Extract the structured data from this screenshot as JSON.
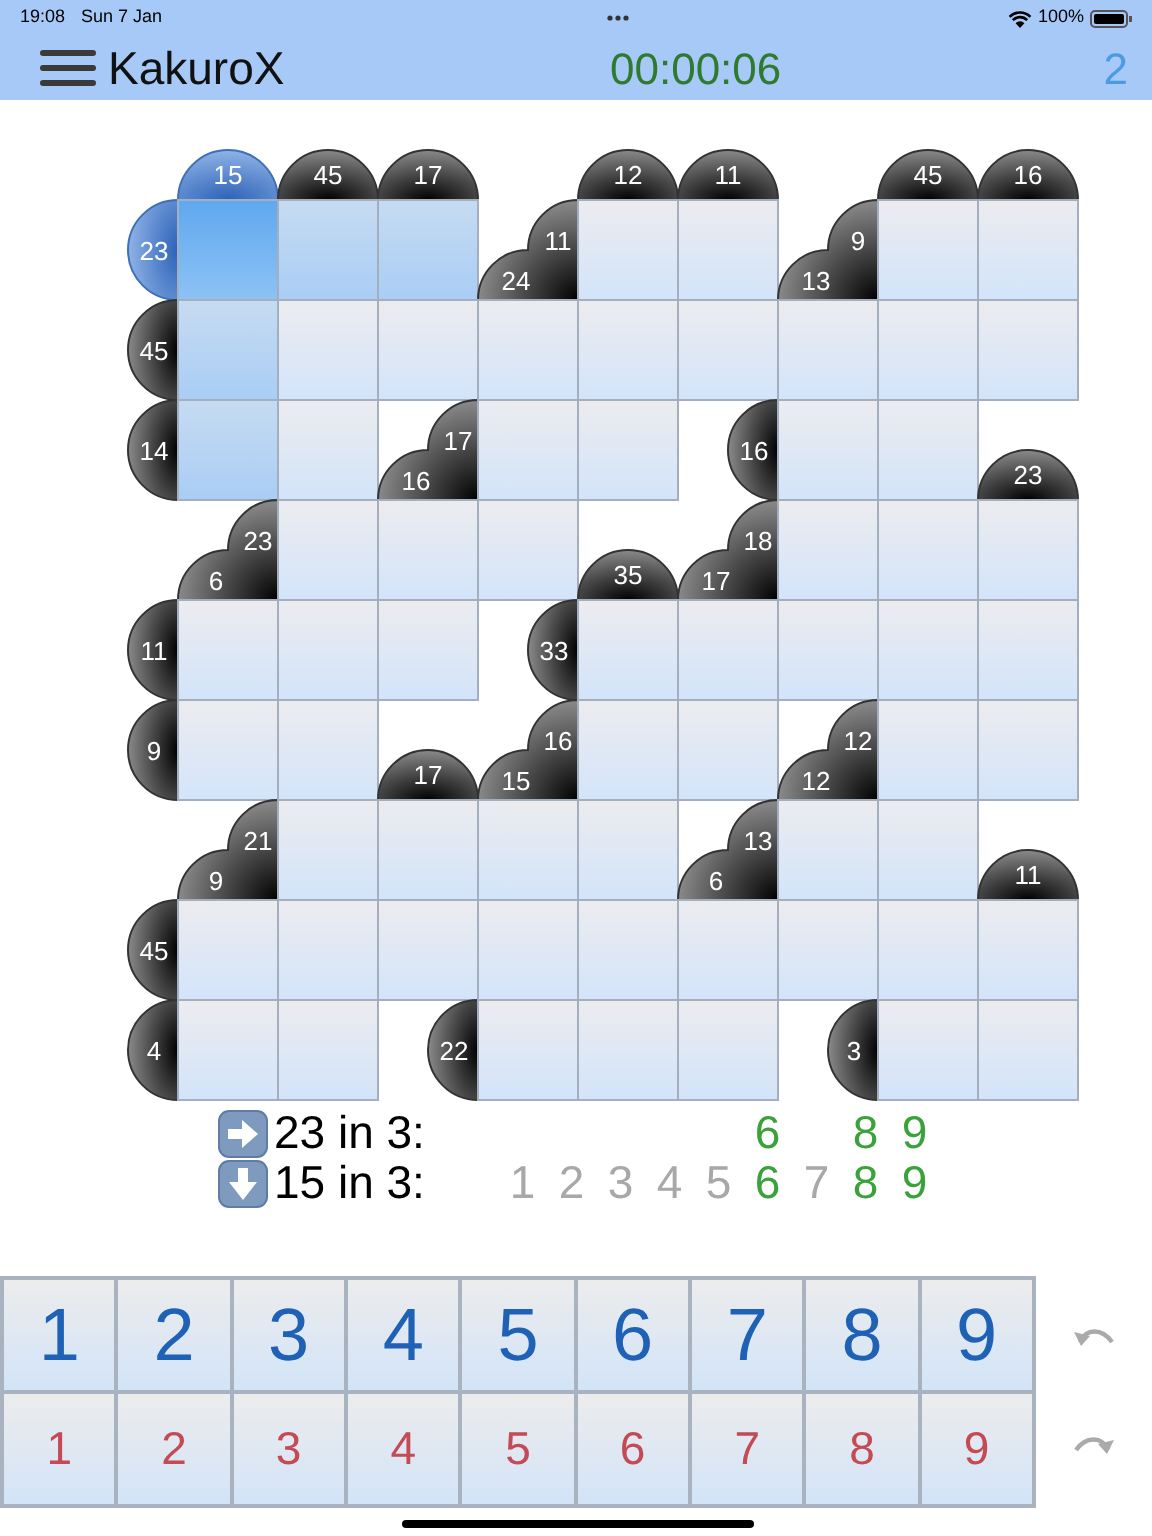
{
  "status_bar": {
    "time": "19:08",
    "date": "Sun 7 Jan",
    "battery": "100%"
  },
  "header": {
    "title": "KakuroX",
    "timer": "00:00:06",
    "count": "2"
  },
  "grid": {
    "rows": [
      [
        {
          "kind": "empty"
        },
        {
          "kind": "clue",
          "down": "15",
          "selected": true
        },
        {
          "kind": "clue",
          "down": "45",
          "selected": false
        },
        {
          "kind": "clue",
          "down": "17",
          "selected": false
        },
        {
          "kind": "empty"
        },
        {
          "kind": "clue",
          "down": "12",
          "selected": false
        },
        {
          "kind": "clue",
          "down": "11",
          "selected": false
        },
        {
          "kind": "empty"
        },
        {
          "kind": "clue",
          "down": "45",
          "selected": false
        },
        {
          "kind": "clue",
          "down": "16",
          "selected": false
        }
      ],
      [
        {
          "kind": "clue",
          "across": "23",
          "selected": true
        },
        {
          "kind": "cell",
          "selected": true
        },
        {
          "kind": "cell",
          "selected": false,
          "highlighted": true
        },
        {
          "kind": "cell",
          "selected": false,
          "highlighted": true
        },
        {
          "kind": "clue",
          "down": "24",
          "across": "11",
          "selected": false
        },
        {
          "kind": "cell",
          "selected": false,
          "highlighted": false
        },
        {
          "kind": "cell",
          "selected": false,
          "highlighted": false
        },
        {
          "kind": "clue",
          "down": "13",
          "across": "9",
          "selected": false
        },
        {
          "kind": "cell",
          "selected": false,
          "highlighted": false
        },
        {
          "kind": "cell",
          "selected": false,
          "highlighted": false
        }
      ],
      [
        {
          "kind": "clue",
          "across": "45",
          "selected": false
        },
        {
          "kind": "cell",
          "selected": false,
          "highlighted": true
        },
        {
          "kind": "cell",
          "selected": false,
          "highlighted": false
        },
        {
          "kind": "cell",
          "selected": false,
          "highlighted": false
        },
        {
          "kind": "cell",
          "selected": false,
          "highlighted": false
        },
        {
          "kind": "cell",
          "selected": false,
          "highlighted": false
        },
        {
          "kind": "cell",
          "selected": false,
          "highlighted": false
        },
        {
          "kind": "cell",
          "selected": false,
          "highlighted": false
        },
        {
          "kind": "cell",
          "selected": false,
          "highlighted": false
        },
        {
          "kind": "cell",
          "selected": false,
          "highlighted": false
        }
      ],
      [
        {
          "kind": "clue",
          "across": "14",
          "selected": false
        },
        {
          "kind": "cell",
          "selected": false,
          "highlighted": true
        },
        {
          "kind": "cell",
          "selected": false,
          "highlighted": false
        },
        {
          "kind": "clue",
          "down": "16",
          "across": "17",
          "selected": false
        },
        {
          "kind": "cell",
          "selected": false,
          "highlighted": false
        },
        {
          "kind": "cell",
          "selected": false,
          "highlighted": false
        },
        {
          "kind": "clue",
          "across": "16",
          "selected": false
        },
        {
          "kind": "cell",
          "selected": false,
          "highlighted": false
        },
        {
          "kind": "cell",
          "selected": false,
          "highlighted": false
        },
        {
          "kind": "clue",
          "down": "23",
          "selected": false
        }
      ],
      [
        {
          "kind": "empty"
        },
        {
          "kind": "clue",
          "down": "6",
          "across": "23",
          "selected": false
        },
        {
          "kind": "cell",
          "selected": false,
          "highlighted": false
        },
        {
          "kind": "cell",
          "selected": false,
          "highlighted": false
        },
        {
          "kind": "cell",
          "selected": false,
          "highlighted": false
        },
        {
          "kind": "clue",
          "down": "35",
          "selected": false
        },
        {
          "kind": "clue",
          "down": "17",
          "across": "18",
          "selected": false
        },
        {
          "kind": "cell",
          "selected": false,
          "highlighted": false
        },
        {
          "kind": "cell",
          "selected": false,
          "highlighted": false
        },
        {
          "kind": "cell",
          "selected": false,
          "highlighted": false
        }
      ],
      [
        {
          "kind": "clue",
          "across": "11",
          "selected": false
        },
        {
          "kind": "cell",
          "selected": false,
          "highlighted": false
        },
        {
          "kind": "cell",
          "selected": false,
          "highlighted": false
        },
        {
          "kind": "cell",
          "selected": false,
          "highlighted": false
        },
        {
          "kind": "clue",
          "across": "33",
          "selected": false
        },
        {
          "kind": "cell",
          "selected": false,
          "highlighted": false
        },
        {
          "kind": "cell",
          "selected": false,
          "highlighted": false
        },
        {
          "kind": "cell",
          "selected": false,
          "highlighted": false
        },
        {
          "kind": "cell",
          "selected": false,
          "highlighted": false
        },
        {
          "kind": "cell",
          "selected": false,
          "highlighted": false
        }
      ],
      [
        {
          "kind": "clue",
          "across": "9",
          "selected": false
        },
        {
          "kind": "cell",
          "selected": false,
          "highlighted": false
        },
        {
          "kind": "cell",
          "selected": false,
          "highlighted": false
        },
        {
          "kind": "clue",
          "down": "17",
          "selected": false
        },
        {
          "kind": "clue",
          "down": "15",
          "across": "16",
          "selected": false
        },
        {
          "kind": "cell",
          "selected": false,
          "highlighted": false
        },
        {
          "kind": "cell",
          "selected": false,
          "highlighted": false
        },
        {
          "kind": "clue",
          "down": "12",
          "across": "12",
          "selected": false
        },
        {
          "kind": "cell",
          "selected": false,
          "highlighted": false
        },
        {
          "kind": "cell",
          "selected": false,
          "highlighted": false
        }
      ],
      [
        {
          "kind": "empty"
        },
        {
          "kind": "clue",
          "down": "9",
          "across": "21",
          "selected": false
        },
        {
          "kind": "cell",
          "selected": false,
          "highlighted": false
        },
        {
          "kind": "cell",
          "selected": false,
          "highlighted": false
        },
        {
          "kind": "cell",
          "selected": false,
          "highlighted": false
        },
        {
          "kind": "cell",
          "selected": false,
          "highlighted": false
        },
        {
          "kind": "clue",
          "down": "6",
          "across": "13",
          "selected": false
        },
        {
          "kind": "cell",
          "selected": false,
          "highlighted": false
        },
        {
          "kind": "cell",
          "selected": false,
          "highlighted": false
        },
        {
          "kind": "clue",
          "down": "11",
          "selected": false
        }
      ],
      [
        {
          "kind": "clue",
          "across": "45",
          "selected": false
        },
        {
          "kind": "cell",
          "selected": false,
          "highlighted": false
        },
        {
          "kind": "cell",
          "selected": false,
          "highlighted": false
        },
        {
          "kind": "cell",
          "selected": false,
          "highlighted": false
        },
        {
          "kind": "cell",
          "selected": false,
          "highlighted": false
        },
        {
          "kind": "cell",
          "selected": false,
          "highlighted": false
        },
        {
          "kind": "cell",
          "selected": false,
          "highlighted": false
        },
        {
          "kind": "cell",
          "selected": false,
          "highlighted": false
        },
        {
          "kind": "cell",
          "selected": false,
          "highlighted": false
        },
        {
          "kind": "cell",
          "selected": false,
          "highlighted": false
        }
      ],
      [
        {
          "kind": "clue",
          "across": "4",
          "selected": false
        },
        {
          "kind": "cell",
          "selected": false,
          "highlighted": false
        },
        {
          "kind": "cell",
          "selected": false,
          "highlighted": false
        },
        {
          "kind": "clue",
          "across": "22",
          "selected": false
        },
        {
          "kind": "cell",
          "selected": false,
          "highlighted": false
        },
        {
          "kind": "cell",
          "selected": false,
          "highlighted": false
        },
        {
          "kind": "cell",
          "selected": false,
          "highlighted": false
        },
        {
          "kind": "clue",
          "across": "3",
          "selected": false
        },
        {
          "kind": "cell",
          "selected": false,
          "highlighted": false
        },
        {
          "kind": "cell",
          "selected": false,
          "highlighted": false
        }
      ]
    ]
  },
  "hints": [
    {
      "kind": "across",
      "label": "23 in 3:",
      "digits": [
        {
          "text": "6",
          "possible": true,
          "gap_before": false
        },
        {
          "text": "8",
          "possible": true,
          "gap_before": true
        },
        {
          "text": "9",
          "possible": true,
          "gap_before": false
        }
      ]
    },
    {
      "kind": "down",
      "label": "15 in 3:",
      "digits": [
        {
          "text": "1",
          "possible": false,
          "gap_before": false
        },
        {
          "text": "2",
          "possible": false,
          "gap_before": false
        },
        {
          "text": "3",
          "possible": false,
          "gap_before": false
        },
        {
          "text": "4",
          "possible": false,
          "gap_before": false
        },
        {
          "text": "5",
          "possible": false,
          "gap_before": false
        },
        {
          "text": "6",
          "possible": true,
          "gap_before": false
        },
        {
          "text": "7",
          "possible": false,
          "gap_before": false
        },
        {
          "text": "8",
          "possible": true,
          "gap_before": false
        },
        {
          "text": "9",
          "possible": true,
          "gap_before": false
        }
      ]
    }
  ],
  "keypad": {
    "entry_keys": [
      "1",
      "2",
      "3",
      "4",
      "5",
      "6",
      "7",
      "8",
      "9"
    ],
    "pencil_keys": [
      "1",
      "2",
      "3",
      "4",
      "5",
      "6",
      "7",
      "8",
      "9"
    ]
  }
}
